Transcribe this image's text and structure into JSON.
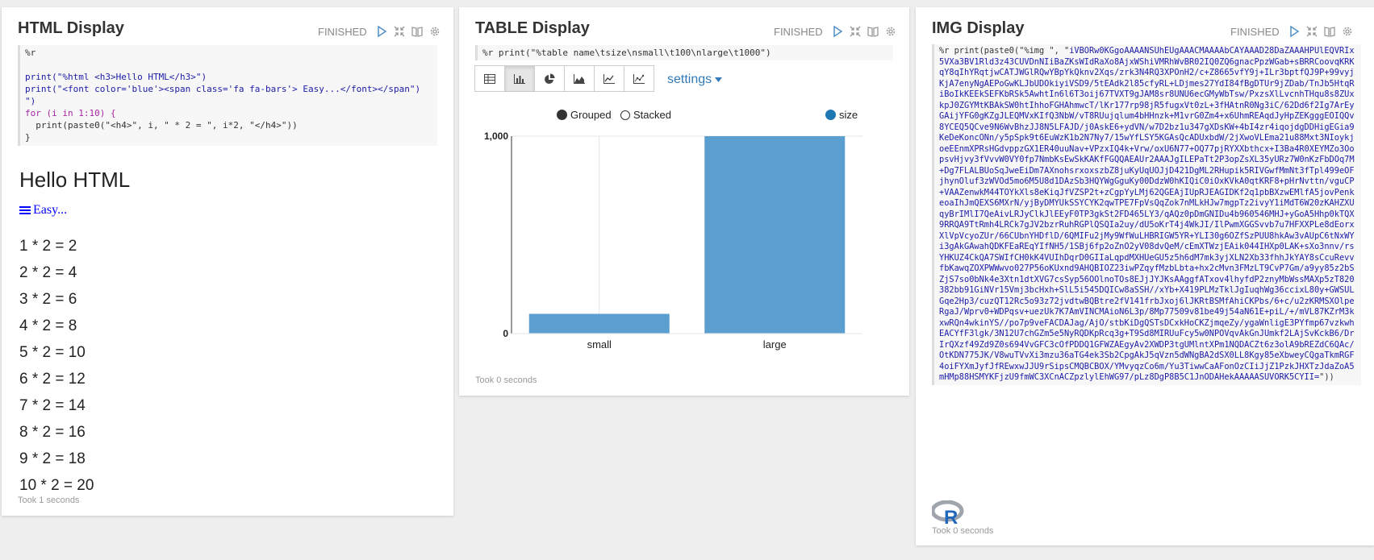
{
  "colors": {
    "accent_blue": "#4f90c9",
    "bar_blue": "#5b9fd0",
    "link_blue": "#337ab7",
    "status_gray": "#888888",
    "background": "#eeeeee"
  },
  "paragraphs": [
    {
      "title": "HTML Display",
      "status": "FINISHED",
      "code_lines": [
        "%r",
        "",
        "print(\"%html <h3>Hello HTML</h3>\")",
        "print(\"<font color='blue'><span class='fa fa-bars'> Easy...</font></span\")",
        "\")",
        "for (i in 1:10) {",
        "  print(paste0(\"<h4>\", i, \" * 2 = \", i*2, \"</h4>\"))",
        "}"
      ],
      "output": {
        "heading": "Hello HTML",
        "link_text": "Easy...",
        "rows": [
          "1 * 2 = 2",
          "2 * 2 = 4",
          "3 * 2 = 6",
          "4 * 2 = 8",
          "5 * 2 = 10",
          "6 * 2 = 12",
          "7 * 2 = 14",
          "8 * 2 = 16",
          "9 * 2 = 18",
          "10 * 2 = 20"
        ]
      },
      "took": "Took 1 seconds"
    },
    {
      "title": "TABLE Display",
      "status": "FINISHED",
      "code": "%r print(\"%table name\\tsize\\nsmall\\t100\\nlarge\\t1000\")",
      "toolbar_icons": [
        "table-icon",
        "bar-chart-icon",
        "pie-chart-icon",
        "area-chart-icon",
        "line-chart-icon",
        "scatter-chart-icon"
      ],
      "settings_label": "settings",
      "legend": {
        "grouped": "Grouped",
        "stacked": "Stacked",
        "series": "size"
      },
      "took": "Took 0 seconds"
    },
    {
      "title": "IMG Display",
      "status": "FINISHED",
      "code_prefix": "%r print(paste0(\"%img \", \"",
      "code_base64": "iVBORw0KGgoAAAANSUhEUgAAACMAAAAbCAYAAAD28DaZAAAHPUlEQVRIx5VXa3BV1Rld3z43CUVDnNIiBaZKsWIdRaXo8AjxWShiVMRhWvBR02IQ0ZQ6gnacPpzWGab+sBRRCoovqKRKqY8qIhYRqtjwCATJWGlRQwYBpYkQknv2Xqs/zrk3N4RQ3XPOnH2/c+Z8665vfY9j+ILr3bptfQJ9P+99vyjKjA7enyNgAEPoGwKLJbUDOkiyiVSD9/5tEAdk2l85cfyRL+LDjmes27YdI84fBgDTUr9jZDab/TnJb5HtqRiBoIkKEEkSEFKbRSk5AwhtIn6l6T3oij67TVXT9gJAM8sr8UNU6ecGMyWbTsw/PxzsXlLvcnhTHqu8s8ZUxkpJ0ZGYMtKBAkSW0htIhhoFGHAhmwcT/lKr177rp98jR5fugxVt0zL+3fHAtnR0Ng3iC/62Dd6f2Ig7ArEyGAijYFG0gKZgJLEQMVxKIfQ3NbW/vT8RUujqlum4bHHnzk+M1vrG0Zm4+x6UhmREAqdJyHpZEKgggEOIQQv8YCEQ5QCve9N6WvBhzJJ8N5LFAJD/j0AskE6+ydVN/w7D2bz1u347gXDsKW+4bI4zr4iqojdgDDHigEGia9KeDeKoncONn/y5pSpk9t6EuWzK1b2N7Ny7/15wYfLSY5KGAsQcADUxbdW/2jXwoVLEma21u88Mxt3NIoykjoeEEnmXPRsHGdvppzGX1ER40uuNav+VPzxIQ4k+Vrw/oxU6N77+OQ77pjRYXXbthcx+I3Ba4R0XEYMZo3OopsvHjvy3fVvvW0VY0fp7NmbKsEwSkKAKfFGQQAEAUr2AAAJgILEPaTt2P3opZsXL35yURz7W0nKzFbDOq7M+Dg7FLALBUoSqJweEiDm7AXnohsrxoxszbZ8juKyUqUOJjD421DgML2RHupik5RIVGwfMmNt3fTpl499eOFjhynOluf3zWVOd5mo6M5U8d1DAzSb3HQYWgGguKy00DdzW0hKIQiC0iOxKVkA0qtKRF8+pHrNvttn/vguCP+VAAZenwkM44TOYkXls8eKiqJfVZSP2t+zCgpYyLMj62QGEAjIUpRJEAGIDKf2q1pbBXzwEMlfA5jovPenkeoaIhJmQEXS6MXrN/yjByDMYUkSSYCYK2qwTPE7FpVsQqZok7nMLkHJw7mgpTz2ivyY1iMdT6W20zKAHZXUqyBrIMlI7QeAivLRJyClkJlEEyF0TP3gkSt2FD465LY3/qAQz0pDmGNIDu4b960546MHJ+yGoA5Hhp0kTQX9RRQA9TtRmh4LRCk7gJV2bzrRuhRGPlQSQIa2uy/dU5oKrT4j4WkJI/IlPwmXGGSvvb7u7HFXXPLe8dEorxXlVpVcyoZUr/66CUbnYHDflD/6QMIFu2jMy9WfWuLHBRIGW5YR+YLI30g6OZfSzPUU8hkAw3vAUpC6tNxWYi3gAkGAwahQDKFEaREqYIfNH5/1SBj6fp2oZnO2yV08dvQeM/cEmXTWzjEAik044IHXp0LAK+sXo3nnv/rsYHKUZ4CkQA7SWIfCH0kK4VUIhDqrD0GIIaLqpdMXHUeGU5z5h6dM7mk3yjXLN2Xb33fhhJkYAY8sCcuRevvfbKawqZOXPWWwvo027P56oKUxnd9AHQBIOZ23iwPZqyfMzbLbta+hx2cMvn3FMzLT9CvP7Gm/a9yy85z2bSZjS7so0bNk4e3Xtn1dtXVG7csSyp56OOlnoTOs8EJjJYJKsAAggfATxov4lhyfdP2znyMbWssMAXp5zT820382bb91GiNVr15Vmj3bcHxh+SlL5i545DQICw8aSSH//xYb+X419PLMzTklJgIuqhWg36ccixL80y+GWSULGqe2Hp3/cuzQT12Rc5o93z72jvdtwBQBtre2fV141frbJxoj6lJKRtBSMfAhiCKPbs/6+c/u2zKRMSXOlpeRgaJ/Wprv0+WDPqsv+uezUk7K7AmVINCMAioN6L3p/8Mp77509v81be49j54aN61E+piL/+/mVL87KZrM3kxwRQn4wkinYS//po7p9veFACDAJag/AjO/stbKiDgQSTsDCxkHoCKZjmqeZy/ygaWnligE3PYfmp67vzkwhEACYfF3lgk/3N12U7chGZm5e5NyRQDKpRcq3g+T9Sd8MIRUuFcy5w0NPOVqvAkGnJUmkf2LAjSvKckB6/DrIrQXzf49Zd9Z0s694VvGFC3cOfPDDQ1GFWZAEgyAv2XWDP3tgUMlntXPm1NQDACZt6z3olA9bREZdC6QAc/OtKDN775JK/V8wuTVvXi3mzu36aTG4ek3Sb2CpgAkJ5qVzn5dWNgBA2dSX0LL8Kgy85eXbweyCQgaTkmRGF4oiFYXmJyfJfREwxwJJU9rSipsCMQBCBOX/YMvyqzCo6m/Yu3TiwwCaAFonOzCIiJjZ1PzkJHXTzJdaZoA5mHMp88HSMYKFjzU9fmWC3XCnACZpzlylEhWG97/pLz8DgP8B5C1JnODAHekAAAAASUVORK5CYII=",
      "code_suffix": "\"))",
      "logo_letter": "R",
      "took": "Took 0 seconds"
    }
  ],
  "chart_data": {
    "type": "bar",
    "categories": [
      "small",
      "large"
    ],
    "series": [
      {
        "name": "size",
        "values": [
          100,
          1000
        ]
      }
    ],
    "ylim": [
      0,
      1000
    ],
    "yticks": [
      "0",
      "1,000"
    ],
    "legend_position": "top-right",
    "grid": true
  }
}
